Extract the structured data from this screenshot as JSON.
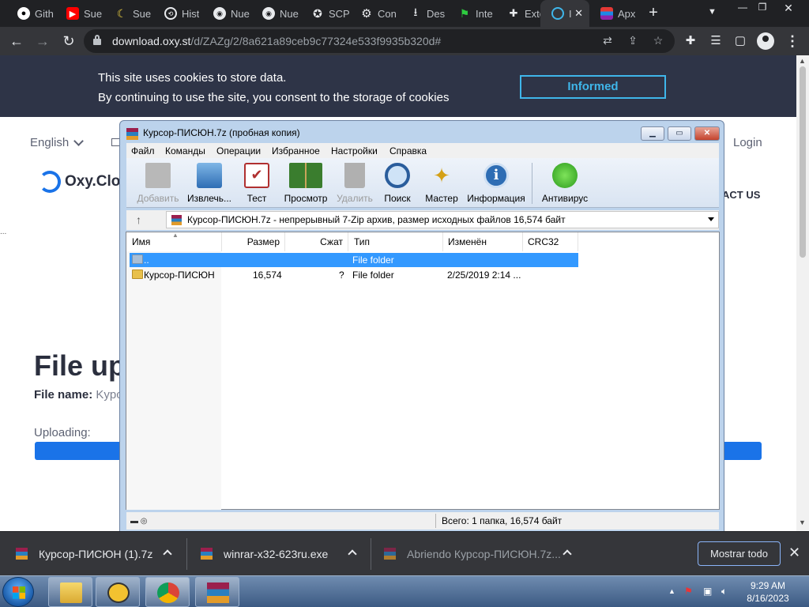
{
  "browser": {
    "tabs": [
      {
        "label": "Gith",
        "icon": "github-icon"
      },
      {
        "label": "Sue",
        "icon": "youtube-icon"
      },
      {
        "label": "Sue",
        "icon": "banana-icon"
      },
      {
        "label": "Hist",
        "icon": "history-icon"
      },
      {
        "label": "Nue",
        "icon": "chrome-icon"
      },
      {
        "label": "Nue",
        "icon": "chrome-icon"
      },
      {
        "label": "SCP",
        "icon": "scp-icon"
      },
      {
        "label": "Con",
        "icon": "gear-icon"
      },
      {
        "label": "Des",
        "icon": "download-icon"
      },
      {
        "label": "Inte",
        "icon": "flag-icon"
      },
      {
        "label": "Exte",
        "icon": "puzzle-icon"
      },
      {
        "label": "I",
        "icon": "oxy-icon"
      },
      {
        "label": "Apx",
        "icon": "apx-icon"
      }
    ],
    "url_host": "download.oxy.st",
    "url_path": "/d/ZAZg/2/8a621a89ceb9c77324e533f9935b320d#"
  },
  "page": {
    "cookie_line1": "This site uses cookies to store data.",
    "cookie_line2": "By continuing to use the site, you consent to the storage of cookies",
    "cookie_button": "Informed",
    "language": "English",
    "login": "Login",
    "logo_text": "Oxy.Clou",
    "nav_contact": "ACT US",
    "stray_dots": "...",
    "title": "File up",
    "file_name_label": "File name:",
    "file_name_value": "Kypc",
    "uploading_label": "Uploading:",
    "upload_progress": 1.0
  },
  "winrar": {
    "title": "Курсор-ПИСЮН.7z (пробная копия)",
    "menu": [
      "Файл",
      "Команды",
      "Операции",
      "Избранное",
      "Настройки",
      "Справка"
    ],
    "toolbar": [
      {
        "label": "Добавить",
        "icon": "add-archive-icon",
        "disabled": true
      },
      {
        "label": "Извлечь...",
        "icon": "extract-icon",
        "disabled": false
      },
      {
        "label": "Тест",
        "icon": "test-icon",
        "disabled": false
      },
      {
        "label": "Просмотр",
        "icon": "view-book-icon",
        "disabled": false
      },
      {
        "label": "Удалить",
        "icon": "delete-trash-icon",
        "disabled": true
      },
      {
        "label": "Поиск",
        "icon": "find-magnifier-icon",
        "disabled": false
      },
      {
        "label": "Мастер",
        "icon": "wizard-wand-icon",
        "disabled": false
      },
      {
        "label": "Информация",
        "icon": "info-icon",
        "disabled": false
      },
      {
        "label": "Антивирус",
        "icon": "antivirus-bug-icon",
        "disabled": false
      }
    ],
    "path": "Курсор-ПИСЮН.7z - непрерывный 7-Zip архив, размер исходных файлов 16,574 байт",
    "columns": [
      "Имя",
      "Размер",
      "Сжат",
      "Тип",
      "Изменён",
      "CRC32"
    ],
    "rows": [
      {
        "name": "..",
        "size": "",
        "packed": "",
        "type": "File folder",
        "modified": "",
        "crc": "",
        "selected": true
      },
      {
        "name": "Курсор-ПИСЮН",
        "size": "16,574",
        "packed": "?",
        "type": "File folder",
        "modified": "2/25/2019 2:14 ...",
        "crc": "",
        "selected": false
      }
    ],
    "status": "Всего: 1 папка, 16,574 байт"
  },
  "downloads": {
    "items": [
      "Курсор-ПИСЮН (1).7z",
      "winrar-x32-623ru.exe",
      "Abriendo Курсор-ПИСЮН.7z..."
    ],
    "show_all": "Mostrar todo"
  },
  "taskbar": {
    "time": "9:29 AM",
    "date": "8/16/2023"
  },
  "colors": {
    "cookie_bg": "#2e3447",
    "accent_blue": "#1a73e8",
    "cookie_button": "#3fb6ea",
    "selection": "#3399ff"
  }
}
